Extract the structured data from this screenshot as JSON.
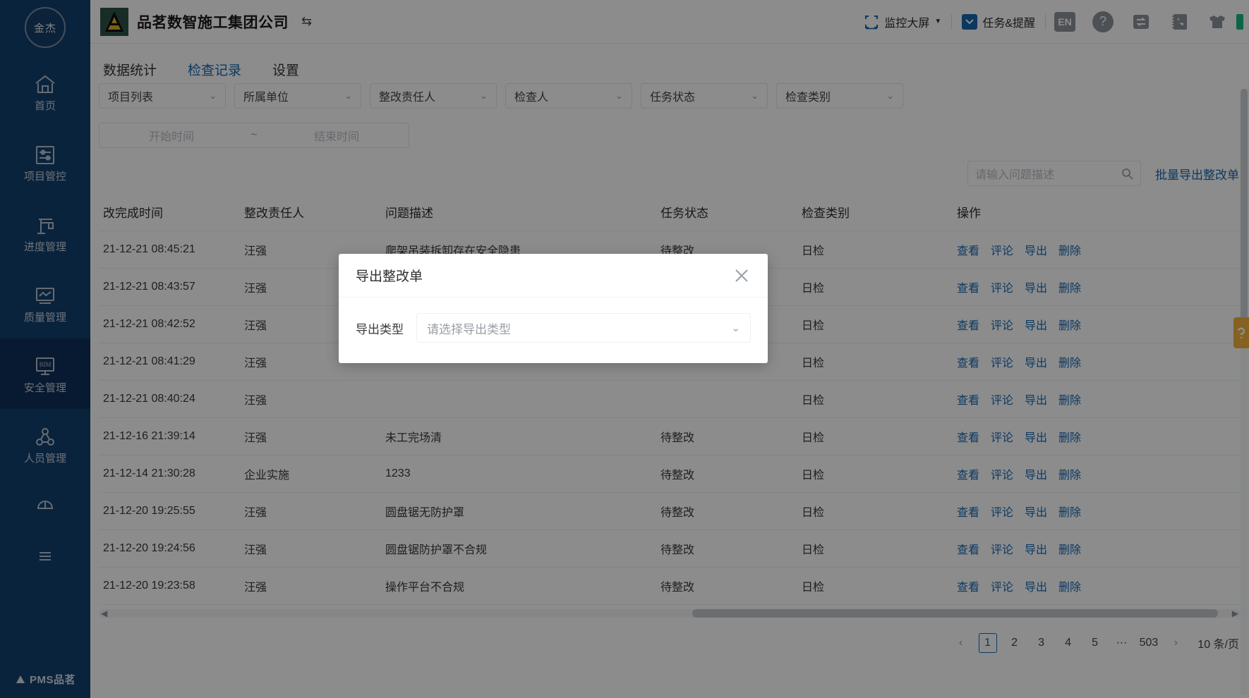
{
  "sidebar": {
    "avatar_text": "金杰",
    "items": [
      {
        "label": "首页",
        "icon": "home-icon",
        "active": false
      },
      {
        "label": "项目管控",
        "icon": "sliders-icon",
        "active": false
      },
      {
        "label": "进度管理",
        "icon": "gantt-icon",
        "active": false
      },
      {
        "label": "质量管理",
        "icon": "chart-monitor-icon",
        "active": false
      },
      {
        "label": "安全管理",
        "icon": "bim-monitor-icon",
        "active": true
      },
      {
        "label": "人员管理",
        "icon": "people-network-icon",
        "active": false
      }
    ],
    "extra_icons": [
      "helmet-icon",
      "menu-icon"
    ],
    "footer_logo": "PMS品茗"
  },
  "header": {
    "company": "品茗数智施工集团公司",
    "switch_glyph": "⇆",
    "monitor": {
      "label": "监控大屏",
      "icon": "fullscreen-brackets-icon",
      "caret": "▼"
    },
    "tasks": {
      "label": "任务&提醒",
      "icon": "mail-icon"
    },
    "lang_chip": "EN",
    "help_glyph": "?",
    "icons": [
      "sync-icon",
      "phonebook-icon",
      "shirt-icon"
    ]
  },
  "tabs": [
    {
      "label": "数据统计",
      "active": false
    },
    {
      "label": "检查记录",
      "active": true
    },
    {
      "label": "设置",
      "active": false
    }
  ],
  "filters": {
    "selects": [
      "项目列表",
      "所属单位",
      "整改责任人",
      "检查人",
      "任务状态",
      "检查类别"
    ],
    "date_start_placeholder": "开始时间",
    "date_tilde": "~",
    "date_end_placeholder": "结束时间"
  },
  "toolbar": {
    "search_placeholder": "请输入问题描述",
    "export_label": "批量导出整改单"
  },
  "table": {
    "columns": [
      "改完成时间",
      "整改责任人",
      "问题描述",
      "任务状态",
      "检查类别",
      "操作"
    ],
    "ops": [
      "查看",
      "评论",
      "导出",
      "删除"
    ],
    "rows": [
      {
        "time": "21-12-21 08:45:21",
        "person": "汪强",
        "desc": "爬架吊装拆卸存在安全隐患",
        "status": "待整改",
        "type": "日检"
      },
      {
        "time": "21-12-21 08:43:57",
        "person": "汪强",
        "desc": "",
        "status": "",
        "type": "日检"
      },
      {
        "time": "21-12-21 08:42:52",
        "person": "汪强",
        "desc": "",
        "status": "",
        "type": "日检"
      },
      {
        "time": "21-12-21 08:41:29",
        "person": "汪强",
        "desc": "",
        "status": "",
        "type": "日检"
      },
      {
        "time": "21-12-21 08:40:24",
        "person": "汪强",
        "desc": "",
        "status": "",
        "type": "日检"
      },
      {
        "time": "21-12-16 21:39:14",
        "person": "汪强",
        "desc": "未工完场清",
        "status": "待整改",
        "type": "日检"
      },
      {
        "time": "21-12-14 21:30:28",
        "person": "企业实施",
        "desc": "1233",
        "status": "待整改",
        "type": "日检"
      },
      {
        "time": "21-12-20 19:25:55",
        "person": "汪强",
        "desc": "圆盘锯无防护罩",
        "status": "待整改",
        "type": "日检"
      },
      {
        "time": "21-12-20 19:24:56",
        "person": "汪强",
        "desc": "圆盘锯防护罩不合规",
        "status": "待整改",
        "type": "日检"
      },
      {
        "time": "21-12-20 19:23:58",
        "person": "汪强",
        "desc": "操作平台不合规",
        "status": "待整改",
        "type": "日检"
      }
    ]
  },
  "pagination": {
    "prev": "‹",
    "pages": [
      "1",
      "2",
      "3",
      "4",
      "5"
    ],
    "ellipsis": "···",
    "last": "503",
    "next": "›",
    "page_size": "10 条/页",
    "current": "1"
  },
  "modal": {
    "title": "导出整改单",
    "close_glyph": "✕",
    "field_label": "导出类型",
    "select_placeholder": "请选择导出类型",
    "select_caret": "⌄"
  },
  "colors": {
    "sidebar_bg": "#134070",
    "sidebar_active": "#0e3159",
    "link_blue": "#1668b3",
    "accent_green": "#19b97f",
    "helper_orange": "#f2b33d"
  }
}
